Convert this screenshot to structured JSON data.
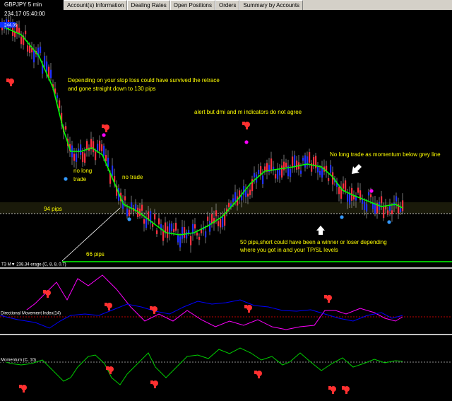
{
  "window": {
    "symbol_label": "GBPJPY 5 min 234.17 05:40:00",
    "tabs": [
      {
        "label": "Account(s) Information"
      },
      {
        "label": "Dealing Rates"
      },
      {
        "label": "Open Positions"
      },
      {
        "label": "Orders"
      },
      {
        "label": "Summary by Accounts"
      }
    ]
  },
  "price_panel": {
    "price_tag": "244.05",
    "indicator_label": "T3 M▼ 238.34 erage (C, 8, 8, 0.7)",
    "annotations": {
      "stop_loss_1": "Depending on your stop loss could have survived the retrace",
      "stop_loss_2": "and gone straight down to 130 pips",
      "alert": "alert but dmi and m indicators do not agree",
      "no_long_1": "no long",
      "no_long_2": "trade",
      "no_trade": "no trade",
      "no_long_momentum": "No long trade as momentum below grey line",
      "pips_94": "94 pips",
      "pips_66": "66 pips",
      "fifty_1": "50 pips,short could have been a winner or loser depending",
      "fifty_2": "where you got in and your TP/SL levels"
    },
    "colors": {
      "bull": "#2030ff",
      "bear": "#ff3040",
      "t3_line": "#00ff00",
      "annotation": "#ffff00"
    }
  },
  "dmi_panel": {
    "label": "Directional Movement Index(14)",
    "colors": {
      "plus_di": "#ff00ff",
      "minus_di": "#0000ff",
      "level": "#ff0000"
    }
  },
  "momentum_panel": {
    "label": "Momentum (C, 10)",
    "colors": {
      "momentum": "#00cc00",
      "level": "#c0c0c0"
    }
  }
}
